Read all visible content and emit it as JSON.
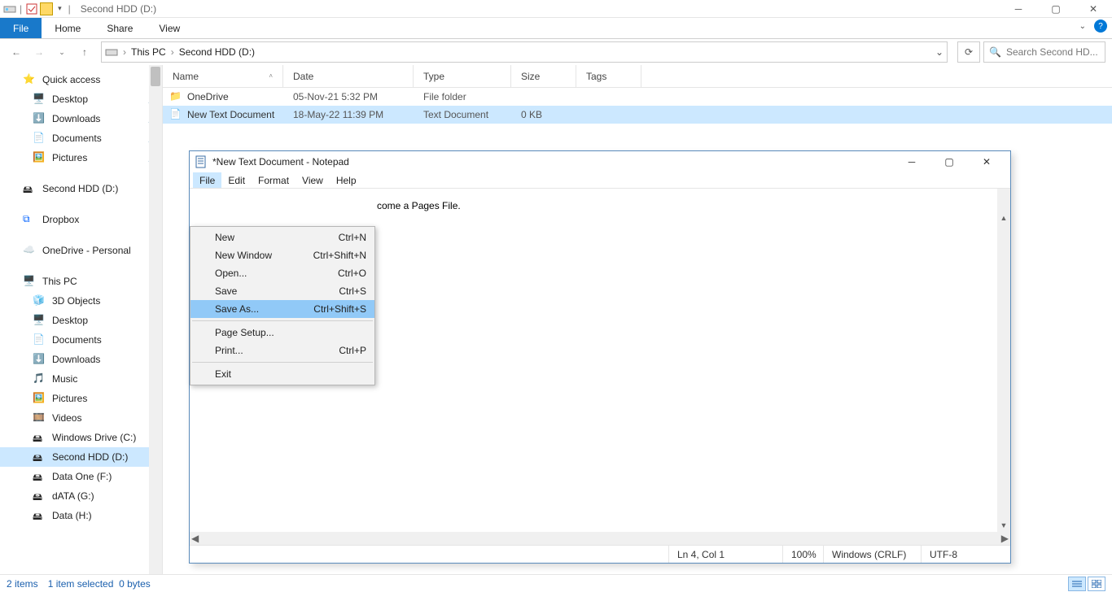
{
  "titlebar": {
    "title": "Second HDD (D:)"
  },
  "ribbon": {
    "file": "File",
    "home": "Home",
    "share": "Share",
    "view": "View"
  },
  "address": {
    "root": "This PC",
    "loc": "Second HDD (D:)"
  },
  "search": {
    "placeholder": "Search Second HD..."
  },
  "columns": {
    "name": "Name",
    "date": "Date",
    "type": "Type",
    "size": "Size",
    "tags": "Tags"
  },
  "rows": [
    {
      "name": "OneDrive",
      "date": "05-Nov-21 5:32 PM",
      "type": "File folder",
      "size": ""
    },
    {
      "name": "New Text Document",
      "date": "18-May-22 11:39 PM",
      "type": "Text Document",
      "size": "0 KB"
    }
  ],
  "nav": {
    "quick": "Quick access",
    "desktop": "Desktop",
    "downloads": "Downloads",
    "documents": "Documents",
    "pictures": "Pictures",
    "secondhdd": "Second HDD (D:)",
    "dropbox": "Dropbox",
    "onedrive": "OneDrive - Personal",
    "thispc": "This PC",
    "objects3d": "3D Objects",
    "desktop2": "Desktop",
    "documents2": "Documents",
    "downloads2": "Downloads",
    "music": "Music",
    "pictures2": "Pictures",
    "videos": "Videos",
    "cdrive": "Windows Drive (C:)",
    "ddrive": "Second HDD (D:)",
    "fdrive": "Data One (F:)",
    "gdrive": "dATA (G:)",
    "hdrive": "Data (H:)"
  },
  "status": {
    "items": "2 items",
    "sel": "1 item selected",
    "bytes": "0 bytes"
  },
  "notepad": {
    "title": "*New Text Document - Notepad",
    "menus": {
      "file": "File",
      "edit": "Edit",
      "format": "Format",
      "view": "View",
      "help": "Help"
    },
    "body_visible": "come a Pages File.",
    "status": {
      "pos": "Ln 4, Col 1",
      "zoom": "100%",
      "eol": "Windows (CRLF)",
      "enc": "UTF-8"
    },
    "filemenu": [
      {
        "label": "New",
        "shortcut": "Ctrl+N"
      },
      {
        "label": "New Window",
        "shortcut": "Ctrl+Shift+N"
      },
      {
        "label": "Open...",
        "shortcut": "Ctrl+O"
      },
      {
        "label": "Save",
        "shortcut": "Ctrl+S"
      },
      {
        "label": "Save As...",
        "shortcut": "Ctrl+Shift+S",
        "hl": true
      },
      {
        "sep": true
      },
      {
        "label": "Page Setup...",
        "shortcut": ""
      },
      {
        "label": "Print...",
        "shortcut": "Ctrl+P"
      },
      {
        "sep": true
      },
      {
        "label": "Exit",
        "shortcut": ""
      }
    ]
  }
}
